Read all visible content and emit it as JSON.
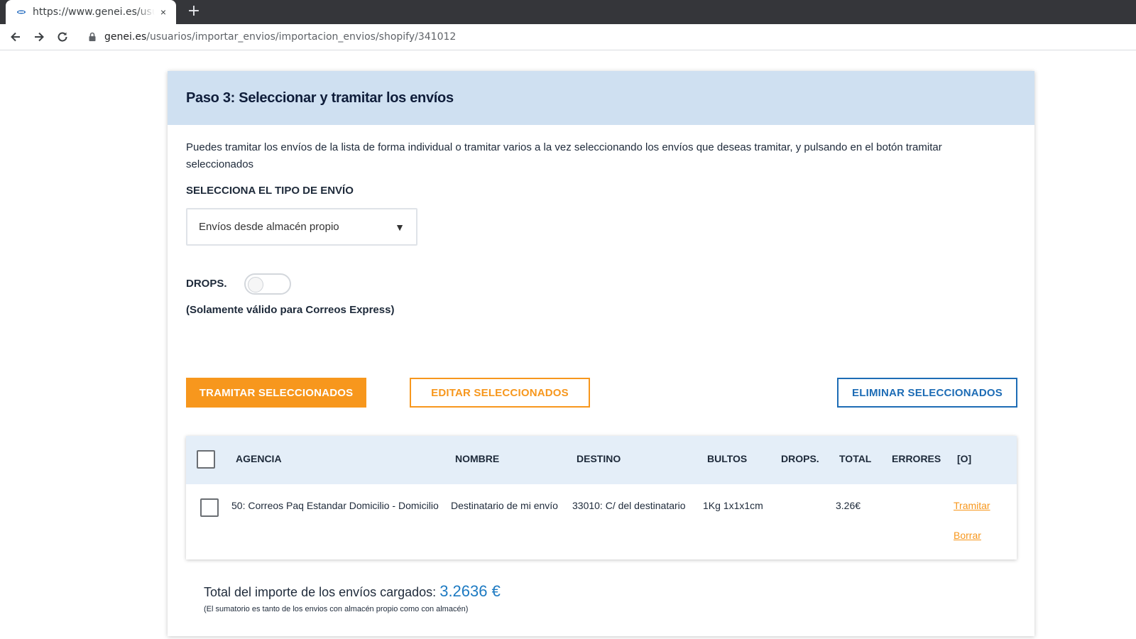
{
  "browser": {
    "tab_title": "https://www.genei.es/usuarios/importar_envios",
    "new_tab_symbol": "+",
    "close_symbol": "×",
    "url_domain": "genei.es",
    "url_path": "/usuarios/importar_envios/importacion_envios/shopify/341012"
  },
  "page": {
    "title": "Paso 3: Seleccionar y tramitar los envíos",
    "description": "Puedes tramitar los envíos de la lista de forma individual o tramitar varios a la vez seleccionando los envíos que deseas tramitar, y pulsando en el botón tramitar seleccionados",
    "tipo_envio_label": "SELECCIONA EL TIPO DE ENVÍO",
    "tipo_envio_value": "Envíos desde almacén propio",
    "drops_label": "DROPS.",
    "drops_enabled": false,
    "drops_note": "(Solamente válido para Correos Express)",
    "buttons": {
      "tramitar": "TRAMITAR SELECCIONADOS",
      "editar": "EDITAR SELECCIONADOS",
      "eliminar": "ELIMINAR SELECCIONADOS"
    },
    "table": {
      "headers": {
        "agencia": "AGENCIA",
        "nombre": "NOMBRE",
        "destino": "DESTINO",
        "bultos": "BULTOS",
        "drops": "DROPS.",
        "total": "TOTAL",
        "errores": "ERRORES",
        "options": "[O]"
      },
      "rows": [
        {
          "agencia": "50: Correos Paq Estandar Domicilio - Domicilio",
          "nombre": "Destinatario de mi envío",
          "destino": "33010: C/ del destinatario",
          "bultos": "1Kg 1x1x1cm",
          "drops": "",
          "total": "3.26€",
          "errores": "",
          "action_tramitar": "Tramitar",
          "action_borrar": "Borrar"
        }
      ]
    },
    "total_label": "Total del importe de los envíos cargados:",
    "total_value": "3.2636 €",
    "total_note": "(El sumatorio es tanto de los envios con almacén propio como con almacén)"
  },
  "colors": {
    "accent_orange": "#f7971d",
    "accent_blue": "#1d6cb5",
    "header_bg": "#cfe0f1"
  }
}
